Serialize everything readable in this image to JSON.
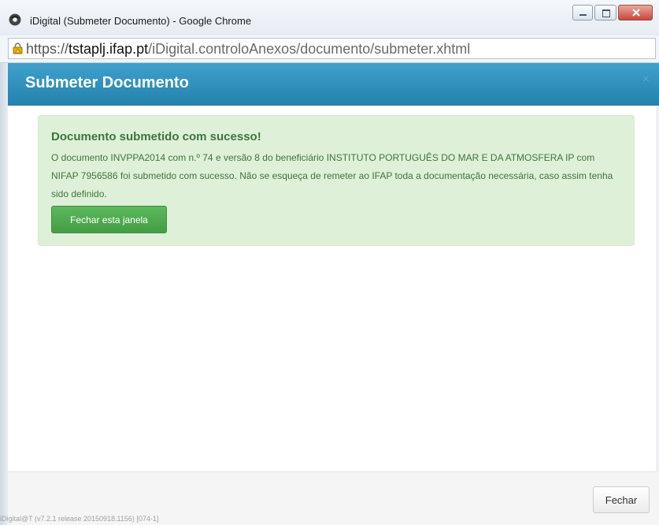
{
  "window": {
    "title": "iDigital (Submeter Documento) - Google Chrome",
    "controls": {
      "minimize_icon": "minimize-icon",
      "maximize_icon": "maximize-icon",
      "close_icon": "close-icon"
    }
  },
  "address_bar": {
    "scheme": "https://",
    "host": "tstaplj.ifap.pt",
    "path": "/iDigital.controloAnexos/documento/submeter.xhtml",
    "icon": "lock-warning-icon"
  },
  "modal": {
    "title": "Submeter Documento",
    "close_glyph": "×",
    "header_color": "#2a8ab8"
  },
  "alert": {
    "title": "Documento submetido com sucesso!",
    "message": "O documento INVPPA2014 com n.º 74 e versão 8 do beneficiário INSTITUTO PORTUGUÊS DO MAR E DA ATMOSFERA IP com NIFAP 7956586 foi submetido com sucesso. Não se esqueça de remeter ao IFAP toda a documentação necessária, caso assim tenha sido definido.",
    "button_label": "Fechar esta janela",
    "color": "#3c763d",
    "background": "#dff0d8"
  },
  "footer": {
    "close_label": "Fechar",
    "version": "iDigital@T (v7.2.1 release 20150918.1156) [074-1]"
  }
}
